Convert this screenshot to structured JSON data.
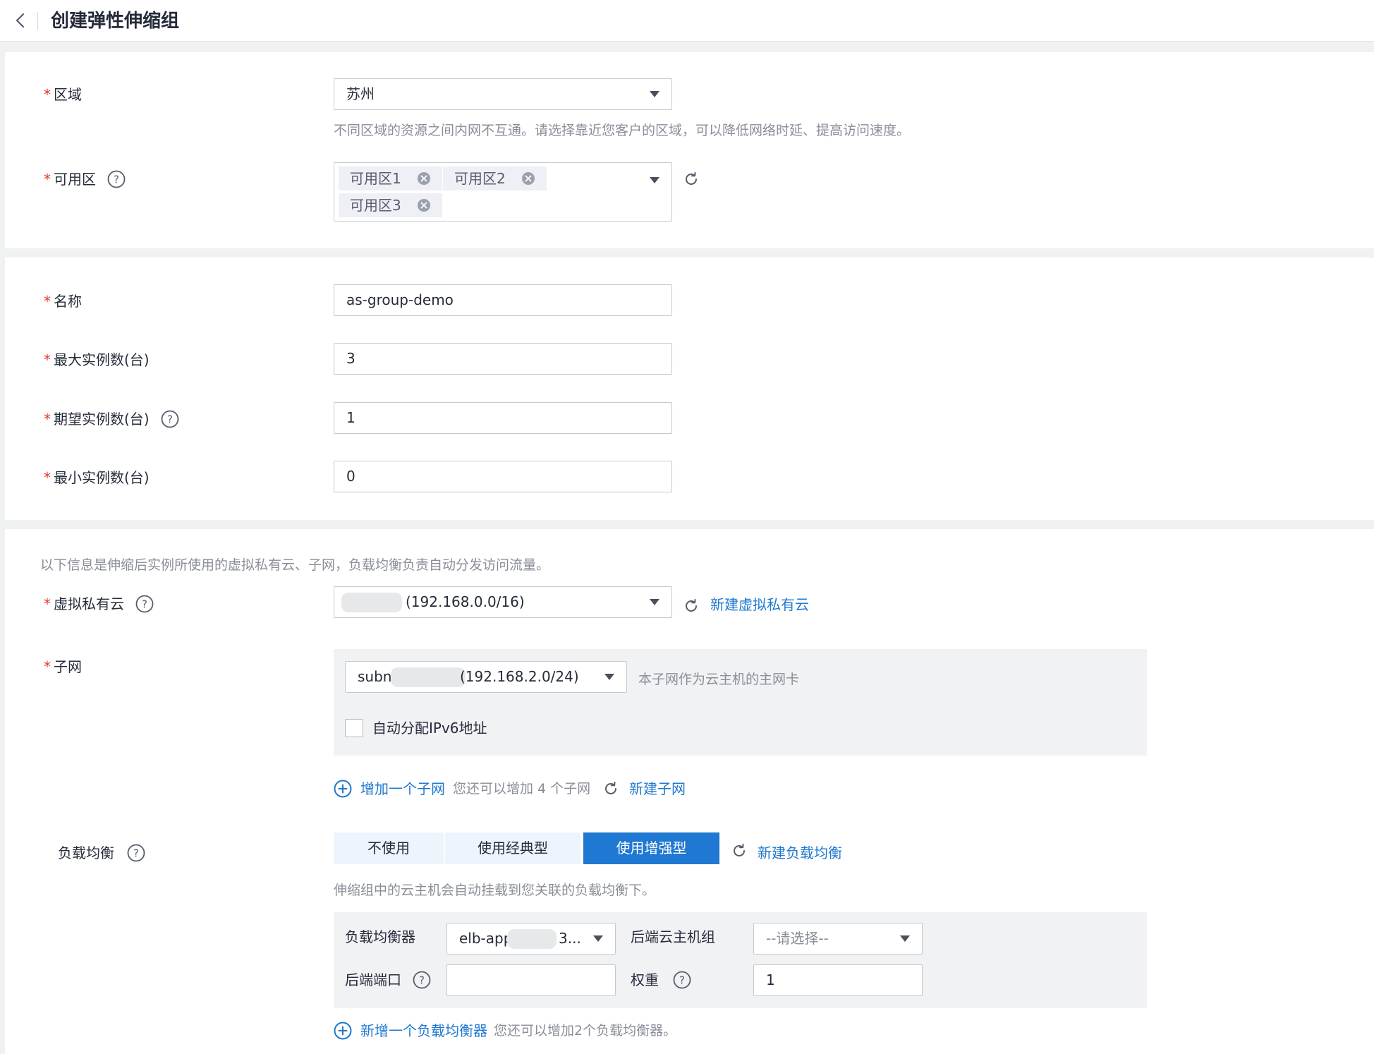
{
  "header": {
    "title": "创建弹性伸缩组"
  },
  "region": {
    "label": "区域",
    "value": "苏州",
    "hint": "不同区域的资源之间内网不互通。请选择靠近您客户的区域，可以降低网络时延、提高访问速度。"
  },
  "az": {
    "label": "可用区",
    "tags": [
      "可用区1",
      "可用区2",
      "可用区3"
    ]
  },
  "basic": {
    "name_label": "名称",
    "name_value": "as-group-demo",
    "max_label": "最大实例数(台)",
    "max_value": "3",
    "expected_label": "期望实例数(台)",
    "expected_value": "1",
    "min_label": "最小实例数(台)",
    "min_value": "0"
  },
  "network": {
    "intro": "以下信息是伸缩后实例所使用的虚拟私有云、子网，负载均衡负责自动分发访问流量。",
    "vpc_label": "虚拟私有云",
    "vpc_value": "(192.168.0.0/16)",
    "vpc_create_link": "新建虚拟私有云",
    "subnet_label": "子网",
    "subnet_prefix": "subn",
    "subnet_value": "(192.168.2.0/24)",
    "subnet_hint": "本子网作为云主机的主网卡",
    "ipv6_label": "自动分配IPv6地址",
    "add_subnet_link": "增加一个子网",
    "add_subnet_hint": "您还可以增加 4 个子网",
    "new_subnet_link": "新建子网"
  },
  "lb": {
    "label": "负载均衡",
    "options": [
      "不使用",
      "使用经典型",
      "使用增强型"
    ],
    "selected": "使用增强型",
    "create_link": "新建负载均衡",
    "hint": "伸缩组中的云主机会自动挂载到您关联的负载均衡下。",
    "balancer_label": "负载均衡器",
    "balancer_prefix": "elb-app",
    "balancer_suffix": "3...",
    "backend_group_label": "后端云主机组",
    "backend_group_placeholder": "--请选择--",
    "backend_port_label": "后端端口",
    "backend_port_value": "",
    "weight_label": "权重",
    "weight_value": "1",
    "add_balancer_link": "新增一个负载均衡器",
    "add_balancer_hint": "您还可以增加2个负载均衡器。"
  },
  "colors": {
    "accent": "#1f78d1",
    "required": "#e0362a",
    "hint": "#8a8e99"
  }
}
